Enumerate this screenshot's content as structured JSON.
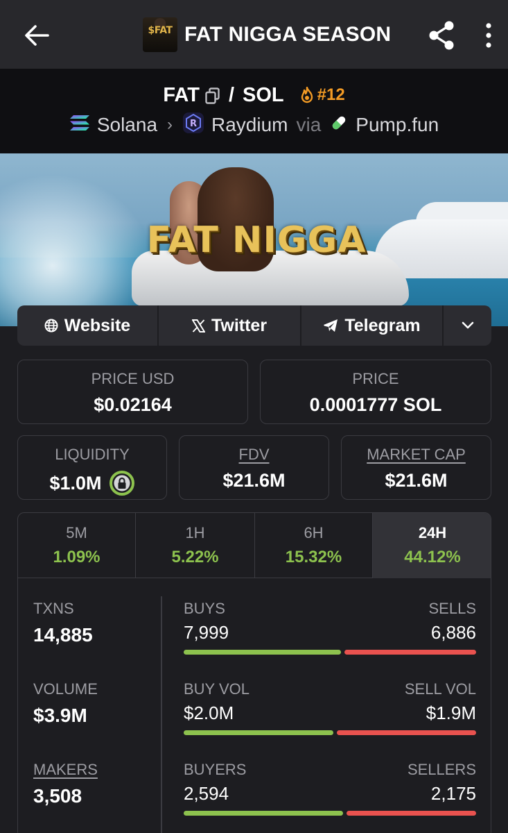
{
  "header": {
    "title": "FAT NIGGA SEASON",
    "logo_text": "$FAT",
    "back_icon": "arrow-left-icon",
    "share_icon": "share-icon",
    "more_icon": "more-vertical-icon"
  },
  "pair": {
    "base": "FAT",
    "separator": "/",
    "quote": "SOL",
    "rank": "#12",
    "chain": "Solana",
    "dex": "Raydium",
    "via": "via",
    "launchpad": "Pump.fun"
  },
  "banner": {
    "text": "FAT NIGGA"
  },
  "links": {
    "website": "Website",
    "twitter": "Twitter",
    "telegram": "Telegram"
  },
  "stats": {
    "price_usd_label": "PRICE USD",
    "price_usd": "$0.02164",
    "price_label": "PRICE",
    "price_native": "0.0001777 SOL",
    "liquidity_label": "LIQUIDITY",
    "liquidity": "$1.0M",
    "fdv_label": "FDV",
    "fdv": "$21.6M",
    "mcap_label": "MARKET CAP",
    "mcap": "$21.6M"
  },
  "timeframes": [
    {
      "label": "5M",
      "change": "1.09%"
    },
    {
      "label": "1H",
      "change": "5.22%"
    },
    {
      "label": "6H",
      "change": "15.32%"
    },
    {
      "label": "24H",
      "change": "44.12%"
    }
  ],
  "active_timeframe": "24H",
  "activity": {
    "txns_label": "TXNS",
    "txns": "14,885",
    "volume_label": "VOLUME",
    "volume": "$3.9M",
    "makers_label": "MAKERS",
    "makers": "3,508",
    "buys_label": "BUYS",
    "buys": "7,999",
    "sells_label": "SELLS",
    "sells": "6,886",
    "buy_share": 0.537,
    "buy_vol_label": "BUY VOL",
    "buy_vol": "$2.0M",
    "sell_vol_label": "SELL VOL",
    "sell_vol": "$1.9M",
    "buy_vol_share": 0.513,
    "buyers_label": "BUYERS",
    "buyers": "2,594",
    "sellers_label": "SELLERS",
    "sellers": "2,175",
    "buyers_share": 0.544
  },
  "colors": {
    "positive": "#8dc24e",
    "negative": "#e9524f",
    "rank": "#f39b25"
  }
}
